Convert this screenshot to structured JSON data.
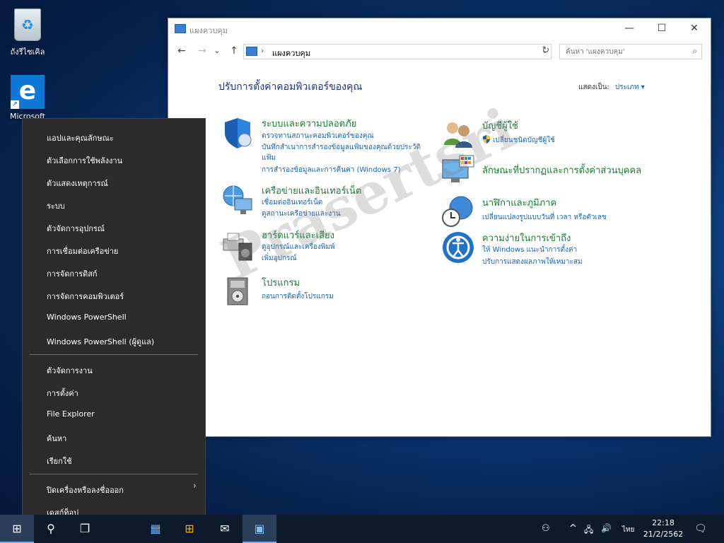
{
  "desktop": {
    "recycle_bin": "ถังรีไซเคิล",
    "edge_line1": "Microsoft",
    "edge_line2": "E"
  },
  "window": {
    "title": "แผงควบคุม",
    "controls": {
      "minimize": "—",
      "maximize": "☐",
      "close": "✕"
    },
    "nav": {
      "back": "←",
      "forward": "→",
      "recent": "⌄",
      "up": "↑"
    },
    "address": {
      "separator": "›",
      "path": "แผงควบคุม",
      "dropdown": "⌄",
      "refresh": "↻"
    },
    "search": {
      "placeholder": "ค้นหา 'แผงควบคุม'",
      "icon": "⌕"
    },
    "heading": "ปรับการตั้งค่าคอมพิวเตอร์ของคุณ",
    "view_by": {
      "label": "แสดงเป็น:",
      "value": "ประเภท ▾"
    },
    "categories_left": [
      {
        "title": "ระบบและความปลอดภัย",
        "links": [
          "ตรวจทานสถานะคอมพิวเตอร์ของคุณ",
          "บันทึกสำเนาการสำรองข้อมูลแฟ้มของคุณด้วยประวัติ",
          "แฟ้ม",
          "การสำรองข้อมูลและการคืนค่า (Windows 7)"
        ]
      },
      {
        "title": "เครือข่ายและอินเทอร์เน็ต",
        "links": [
          "เชื่อมต่ออินเทอร์เน็ต",
          "ดูสถานะเครือข่ายและงาน"
        ]
      },
      {
        "title": "ฮาร์ดแวร์และเสียง",
        "links": [
          "ดูอุปกรณ์และเครื่องพิมพ์",
          "เพิ่มอุปกรณ์"
        ]
      },
      {
        "title": "โปรแกรม",
        "links": [
          "ถอนการติดตั้งโปรแกรม"
        ]
      }
    ],
    "categories_right": [
      {
        "title": "บัญชีผู้ใช้",
        "links": [
          "เปลี่ยนชนิดบัญชีผู้ใช้"
        ]
      },
      {
        "title": "ลักษณะที่ปรากฏและการตั้งค่าส่วนบุคคล",
        "links": []
      },
      {
        "title": "นาฬิกาและภูมิภาค",
        "links": [
          "เปลี่ยนแปลงรูปแบบวันที่ เวลา หรือตัวเลข"
        ]
      },
      {
        "title": "ความง่ายในการเข้าถึง",
        "links": [
          "ให้ Windows แนะนำการตั้งค่า",
          "ปรับการแสดงผลภาพให้เหมาะสม"
        ]
      }
    ],
    "watermark": "Prasertsri"
  },
  "winx_menu": {
    "group1": [
      "แอปและคุณลักษณะ",
      "ตัวเลือกการใช้พลังงาน",
      "ตัวแสดงเหตุการณ์",
      "ระบบ",
      "ตัวจัดการอุปกรณ์",
      "การเชื่อมต่อเครือข่าย",
      "การจัดการดิสก์",
      "การจัดการคอมพิวเตอร์",
      "Windows PowerShell",
      "Windows PowerShell (ผู้ดูแล)"
    ],
    "group2": [
      "ตัวจัดการงาน",
      "การตั้งค่า",
      "File Explorer",
      "ค้นหา",
      "เรียกใช้"
    ],
    "group3": [
      "ปิดเครื่องหรือลงชื่อออก",
      "เดสก์ท็อป"
    ],
    "submenu_arrow": "›"
  },
  "taskbar": {
    "icons": {
      "start": "⊞",
      "search": "⚲",
      "taskview": "❐",
      "store": "▦",
      "windows": "⊞",
      "mail": "✉",
      "control_panel": "▣"
    },
    "tray": {
      "people": "⚇",
      "chevron": "^",
      "network": "🖧",
      "volume": "🔊",
      "language": "ไทย",
      "notifications": "🗨"
    },
    "time": "22:18",
    "date": "21/2/2562"
  }
}
